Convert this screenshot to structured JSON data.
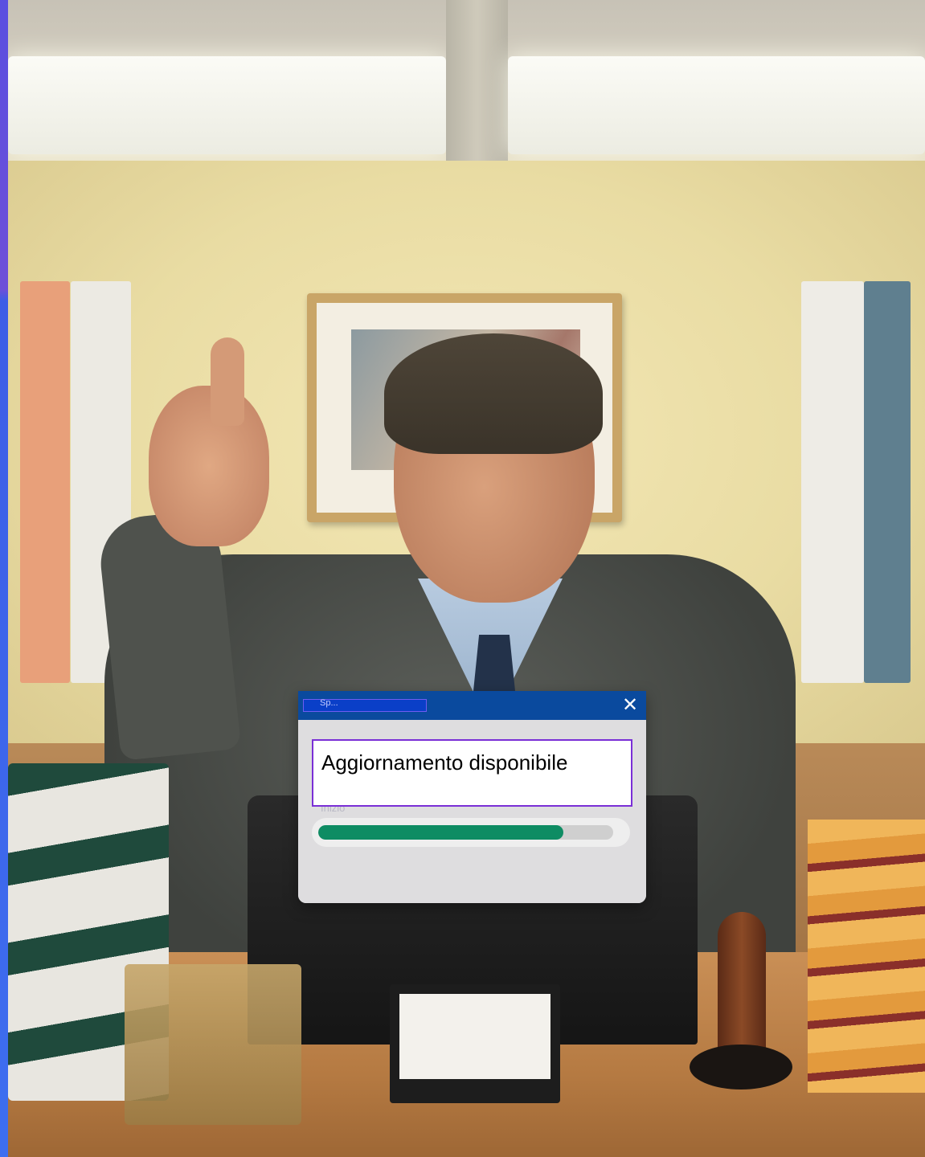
{
  "dialog": {
    "title": "Sp...",
    "close_label": "✕",
    "message": "Aggiornamento disponibile",
    "sublabel": "Inizio",
    "progress_fraction": 0.83
  },
  "nameplate": {
    "line1": "",
    "line2": ""
  },
  "colors": {
    "titlebar": "#0a4a9e",
    "progress": "#0e8c63",
    "message_border": "#7a2fd6"
  },
  "icons": {
    "close": "close-icon"
  }
}
